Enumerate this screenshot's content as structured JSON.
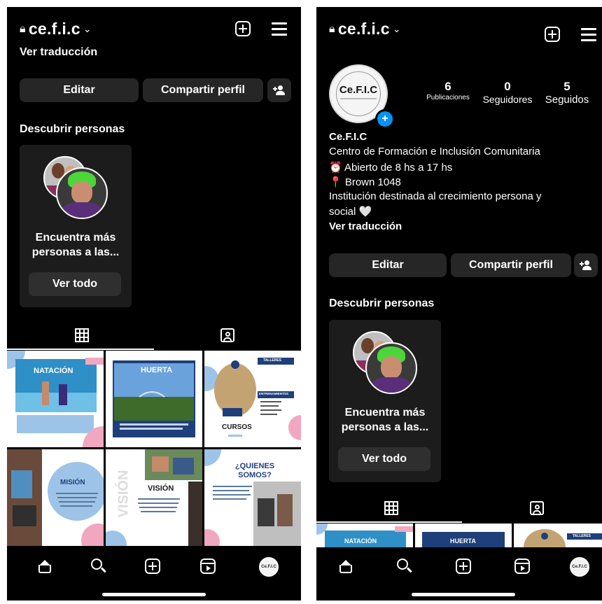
{
  "left": {
    "username": "ce.f.i.c",
    "see_translation": "Ver traducción",
    "edit_label": "Editar",
    "share_label": "Compartir perfil",
    "discover_title": "Descubrir personas",
    "card": {
      "line1": "Encuentra más",
      "line2": "personas a las...",
      "button": "Ver todo"
    },
    "tiles": [
      {
        "label": "NATACIÓN"
      },
      {
        "label": "HUERTA"
      },
      {
        "label": "CURSOS",
        "side": "TALLERES",
        "side2": "ENTRENAMIENTOS"
      },
      {
        "label": "MISIÓN"
      },
      {
        "label": "VISIÓN",
        "vertical": "VISIÓN"
      },
      {
        "label": "¿QUIENES SOMOS?"
      }
    ]
  },
  "right": {
    "username": "ce.f.i.c",
    "logo_text": "Ce.F.I.C",
    "stats": [
      {
        "value": "6",
        "label": "Publicaciones"
      },
      {
        "value": "0",
        "label": "Seguidores"
      },
      {
        "value": "5",
        "label": "Seguidos"
      }
    ],
    "bio": {
      "name": "Ce.F.I.C",
      "line1": "Centro de Formación e Inclusión Comunitaria",
      "line2": "⏰ Abierto de 8 hs a 17 hs",
      "line3": "📍 Brown 1048",
      "line4": "Institución destinada al crecimiento persona y",
      "line5": "social 🤍",
      "translate": "Ver traducción"
    },
    "edit_label": "Editar",
    "share_label": "Compartir perfil",
    "discover_title": "Descubrir personas",
    "card": {
      "line1": "Encuentra más",
      "line2": "personas a las...",
      "button": "Ver todo"
    },
    "tiles": [
      {
        "label": "NATACIÓN"
      },
      {
        "label": "HUERTA"
      },
      {
        "label": "TALLERES"
      }
    ]
  },
  "nav_avatar_text": "Ce.F.I.C",
  "icons": {
    "lock": "lock-icon",
    "chevron": "chevron-down-icon",
    "new_post": "plus-square-icon",
    "menu": "hamburger-menu-icon",
    "discover": "add-person-icon",
    "grid": "grid-icon",
    "tagged": "tagged-person-icon",
    "home": "home-icon",
    "search": "search-icon",
    "create": "plus-square-icon",
    "reels": "reels-icon"
  },
  "colors": {
    "background": "#000000",
    "button": "#262626",
    "card": "#1c1c1c",
    "accent_blue": "#0095f6",
    "tile_blue": "#9dc4e8",
    "tile_pink": "#f2a7c0"
  }
}
